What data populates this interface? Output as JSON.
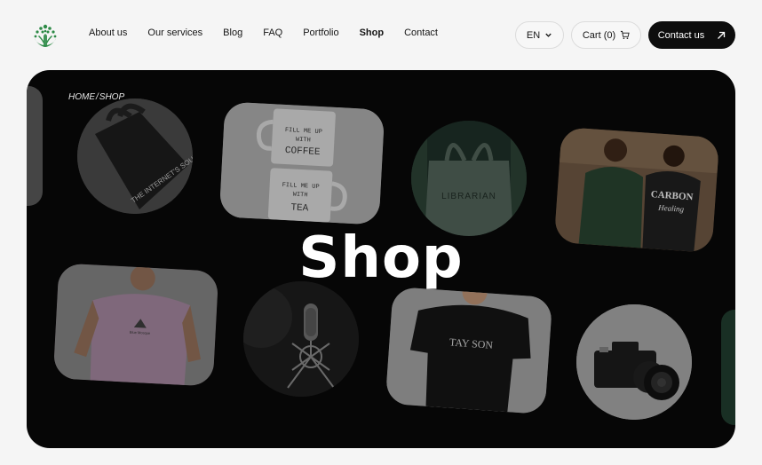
{
  "header": {
    "nav": [
      "About us",
      "Our services",
      "Blog",
      "FAQ",
      "Portfolio",
      "Shop",
      "Contact"
    ],
    "active_nav": "Shop",
    "language": "EN",
    "cart_label": "Cart (0)",
    "contact_label": "Contact us"
  },
  "hero": {
    "breadcrumb_home": "HOME",
    "breadcrumb_sep": "/",
    "breadcrumb_current": "SHOP",
    "title": "Shop"
  },
  "products": {
    "tote_text": "THE INTERNET'S SOURCE OF IMAGES.",
    "mug_text_1": "FILL ME UP WITH COFFEE",
    "mug_text_2": "FILL ME UP WITH TEA",
    "bag_text": "LIBRARIAN",
    "tshirt_back_text": "CARBON",
    "tshirt_black_text": "TAY SON"
  },
  "colors": {
    "hero_bg": "#080808",
    "accent_button": "#0d0d0d",
    "logo_green": "#2e8b47"
  }
}
